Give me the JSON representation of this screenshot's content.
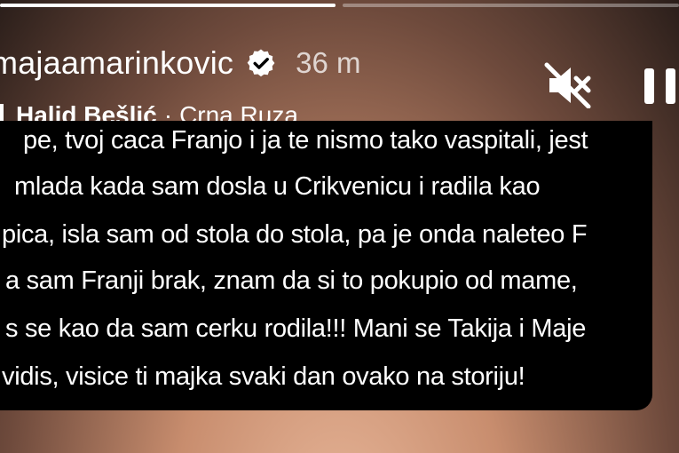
{
  "story": {
    "progress": [
      1.0,
      0.0
    ],
    "username": "majaamarinkovic",
    "time": "36 m",
    "music": {
      "artist": "Halid Bešlić",
      "separator": "·",
      "song": "Crna Ruza"
    },
    "text_lines": [
      "pe, tvoj caca Franjo i ja te nismo tako vaspitali, jest",
      "mlada kada sam dosla u Crikvenicu i radila kao",
      "pica, isla sam od stola do stola, pa je onda naleteo F",
      "a sam Franji brak, znam da si to pokupio od mame,",
      "s se kao da sam cerku rodila!!! Mani se Takija i Maje",
      "vidis, visice ti majka svaki dan ovako na storiju!"
    ]
  },
  "icons": {
    "verified": "verified-badge-icon",
    "music": "music-note-icon",
    "mute": "speaker-muted-icon",
    "pause": "pause-icon"
  },
  "colors": {
    "text": "#ffffff",
    "textbox": "#000000",
    "muted_text": "#bfbfbf"
  }
}
